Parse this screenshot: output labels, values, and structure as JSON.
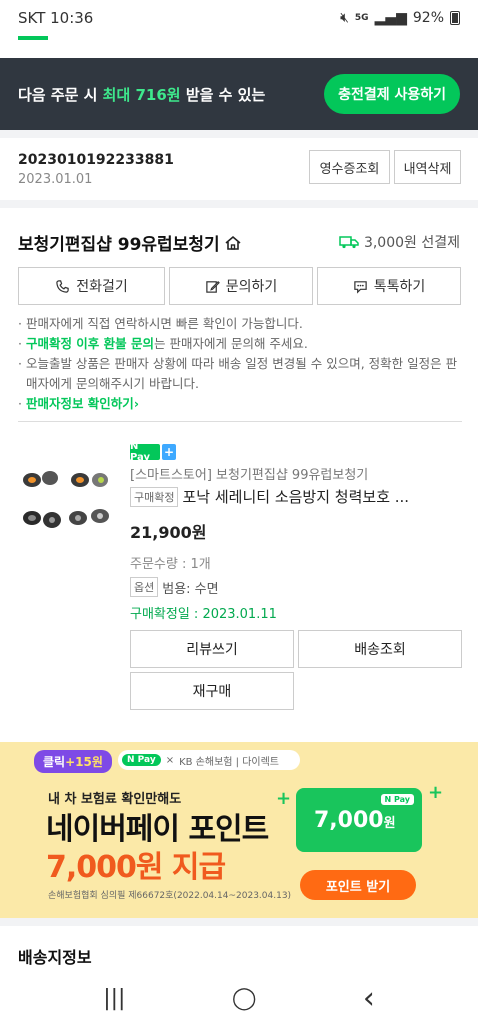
{
  "status_bar": {
    "carrier_time": "SKT 10:36",
    "network": "5G",
    "battery": "92%"
  },
  "promo": {
    "text_prefix": "다음 주문 시 ",
    "text_highlight": "최대 716원",
    "text_suffix": " 받을 수 있는",
    "button": "충전결제 사용하기"
  },
  "order": {
    "number": "2023010192233881",
    "date": "2023.01.01",
    "receipt_button": "영수증조회",
    "delete_button": "내역삭제"
  },
  "store": {
    "name": "보청기편집샵 99유럽보청기",
    "shipping_fee": "3,000원 선결제",
    "call_button": "전화걸기",
    "inquiry_button": "문의하기",
    "talk_button": "톡톡하기",
    "notes": {
      "line1": "판매자에게 직접 연락하시면 빠른 확인이 가능합니다.",
      "line2_highlight": "구매확정 이후 환불 문의",
      "line2_rest": "는 판매자에게 문의해 주세요.",
      "line3": "오늘출발 상품은 판매자 상황에 따라 배송 일정 변경될 수 있으며, 정확한 일정은 판매자에게 문의해주시기 바랍니다.",
      "seller_info_link": "판매자정보 확인하기"
    }
  },
  "product": {
    "npay_label": "N Pay",
    "npay_plus": "+",
    "seller_line": "[스마트스토어] 보청기편집샵 99유럽보청기",
    "status_tag": "구매확정",
    "title": "포낙 세레니티 소음방지 청력보호 ...",
    "price": "21,900원",
    "quantity": "주문수량 : 1개",
    "option_tag": "옵션",
    "option_value": "범용: 수면",
    "confirm_date": "구매확정일 : 2023.01.11",
    "review_button": "리뷰쓰기",
    "tracking_button": "배송조회",
    "reorder_button": "재구매"
  },
  "banner": {
    "badge_prefix": "클릭",
    "badge_value": "+15원",
    "partner_npay": "N Pay",
    "partner_x": "×",
    "partner_text": "KB 손해보험 | 다이렉트",
    "subtitle": "내 차 보험료 확인만해도",
    "headline1": "네이버페이 포인트",
    "headline2": "7,000원 지급",
    "fine_print": "손해보험협회 심의필 제66672호(2022.04.14~2023.04.13)",
    "card_npay": "N Pay",
    "card_amount": "7,000",
    "card_unit": "원",
    "button": "포인트 받기"
  },
  "shipping_section_title": "배송지정보",
  "nav": {
    "recents": "|||",
    "home": "◯",
    "back": "‹"
  }
}
